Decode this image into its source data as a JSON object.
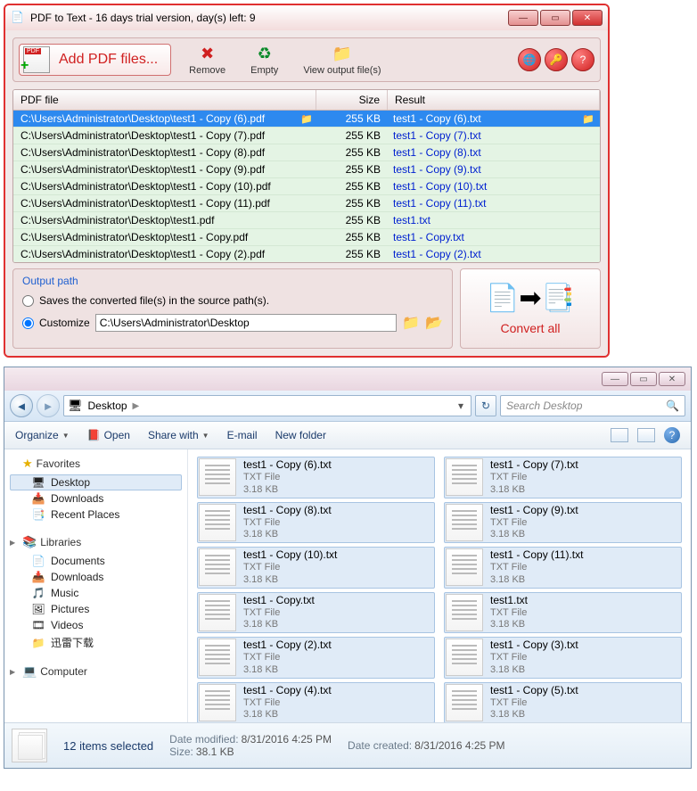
{
  "app": {
    "title": "PDF to Text - 16 days trial version, day(s) left: 9",
    "toolbar": {
      "add_label": "Add PDF files...",
      "remove_label": "Remove",
      "empty_label": "Empty",
      "view_label": "View output file(s)"
    },
    "table": {
      "head_file": "PDF file",
      "head_size": "Size",
      "head_result": "Result",
      "rows": [
        {
          "file": "C:\\Users\\Administrator\\Desktop\\test1 - Copy (6).pdf",
          "size": "255 KB",
          "result": "test1 - Copy (6).txt",
          "selected": true
        },
        {
          "file": "C:\\Users\\Administrator\\Desktop\\test1 - Copy (7).pdf",
          "size": "255 KB",
          "result": "test1 - Copy (7).txt"
        },
        {
          "file": "C:\\Users\\Administrator\\Desktop\\test1 - Copy (8).pdf",
          "size": "255 KB",
          "result": "test1 - Copy (8).txt"
        },
        {
          "file": "C:\\Users\\Administrator\\Desktop\\test1 - Copy (9).pdf",
          "size": "255 KB",
          "result": "test1 - Copy (9).txt"
        },
        {
          "file": "C:\\Users\\Administrator\\Desktop\\test1 - Copy (10).pdf",
          "size": "255 KB",
          "result": "test1 - Copy (10).txt"
        },
        {
          "file": "C:\\Users\\Administrator\\Desktop\\test1 - Copy (11).pdf",
          "size": "255 KB",
          "result": "test1 - Copy (11).txt"
        },
        {
          "file": "C:\\Users\\Administrator\\Desktop\\test1.pdf",
          "size": "255 KB",
          "result": "test1.txt"
        },
        {
          "file": "C:\\Users\\Administrator\\Desktop\\test1 - Copy.pdf",
          "size": "255 KB",
          "result": "test1 - Copy.txt"
        },
        {
          "file": "C:\\Users\\Administrator\\Desktop\\test1 - Copy (2).pdf",
          "size": "255 KB",
          "result": "test1 - Copy (2).txt"
        }
      ]
    },
    "output": {
      "title": "Output path",
      "opt_source": "Saves the converted file(s) in the source path(s).",
      "opt_custom": "Customize",
      "custom_path": "C:\\Users\\Administrator\\Desktop"
    },
    "convert_label": "Convert all"
  },
  "explorer": {
    "address": {
      "location": "Desktop"
    },
    "search_placeholder": "Search Desktop",
    "toolbar": {
      "organize": "Organize",
      "open": "Open",
      "share": "Share with",
      "email": "E-mail",
      "newfolder": "New folder"
    },
    "sidebar": {
      "favorites": {
        "label": "Favorites",
        "items": [
          {
            "label": "Desktop",
            "ico": "🖥",
            "selected": true
          },
          {
            "label": "Downloads",
            "ico": "📥"
          },
          {
            "label": "Recent Places",
            "ico": "📑"
          }
        ]
      },
      "libraries": {
        "label": "Libraries",
        "items": [
          {
            "label": "Documents",
            "ico": "📄"
          },
          {
            "label": "Downloads",
            "ico": "📥"
          },
          {
            "label": "Music",
            "ico": "🎵"
          },
          {
            "label": "Pictures",
            "ico": "🖼"
          },
          {
            "label": "Videos",
            "ico": "🎞"
          },
          {
            "label": "迅雷下载",
            "ico": "📁"
          }
        ]
      },
      "computer": {
        "label": "Computer"
      }
    },
    "files": [
      {
        "name": "test1 - Copy (6).txt",
        "type": "TXT File",
        "size": "3.18 KB"
      },
      {
        "name": "test1 - Copy (7).txt",
        "type": "TXT File",
        "size": "3.18 KB"
      },
      {
        "name": "test1 - Copy (8).txt",
        "type": "TXT File",
        "size": "3.18 KB"
      },
      {
        "name": "test1 - Copy (9).txt",
        "type": "TXT File",
        "size": "3.18 KB"
      },
      {
        "name": "test1 - Copy (10).txt",
        "type": "TXT File",
        "size": "3.18 KB"
      },
      {
        "name": "test1 - Copy (11).txt",
        "type": "TXT File",
        "size": "3.18 KB"
      },
      {
        "name": "test1 - Copy.txt",
        "type": "TXT File",
        "size": "3.18 KB"
      },
      {
        "name": "test1.txt",
        "type": "TXT File",
        "size": "3.18 KB"
      },
      {
        "name": "test1 - Copy (2).txt",
        "type": "TXT File",
        "size": "3.18 KB"
      },
      {
        "name": "test1 - Copy (3).txt",
        "type": "TXT File",
        "size": "3.18 KB"
      },
      {
        "name": "test1 - Copy (4).txt",
        "type": "TXT File",
        "size": "3.18 KB"
      },
      {
        "name": "test1 - Copy (5).txt",
        "type": "TXT File",
        "size": "3.18 KB"
      }
    ],
    "status": {
      "selection": "12 items selected",
      "modified_k": "Date modified:",
      "modified_v": "8/31/2016 4:25 PM",
      "created_k": "Date created:",
      "created_v": "8/31/2016 4:25 PM",
      "size_k": "Size:",
      "size_v": "38.1 KB"
    }
  }
}
